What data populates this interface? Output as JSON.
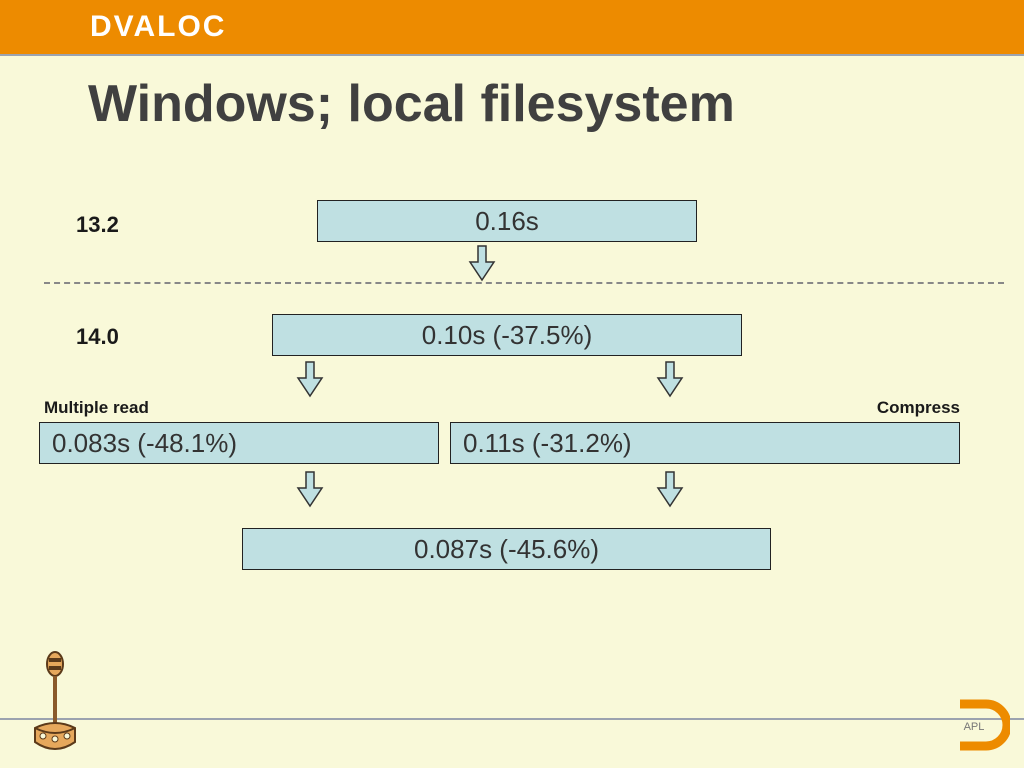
{
  "brand": {
    "logo": "DVALOC",
    "badge": "APL"
  },
  "title": "Windows; local filesystem",
  "labels": {
    "v132": "13.2",
    "v140": "14.0",
    "multiple_read": "Multiple read",
    "compress": "Compress"
  },
  "boxes": {
    "baseline": "0.16s",
    "v140": "0.10s (-37.5%)",
    "multiple_read": "0.083s (-48.1%)",
    "compress": "0.11s (-31.2%)",
    "combined": "0.087s (-45.6%)"
  },
  "colors": {
    "brand": "#ed8b00",
    "page_bg": "#f9f9d9",
    "box_fill": "#bfe0e2"
  }
}
